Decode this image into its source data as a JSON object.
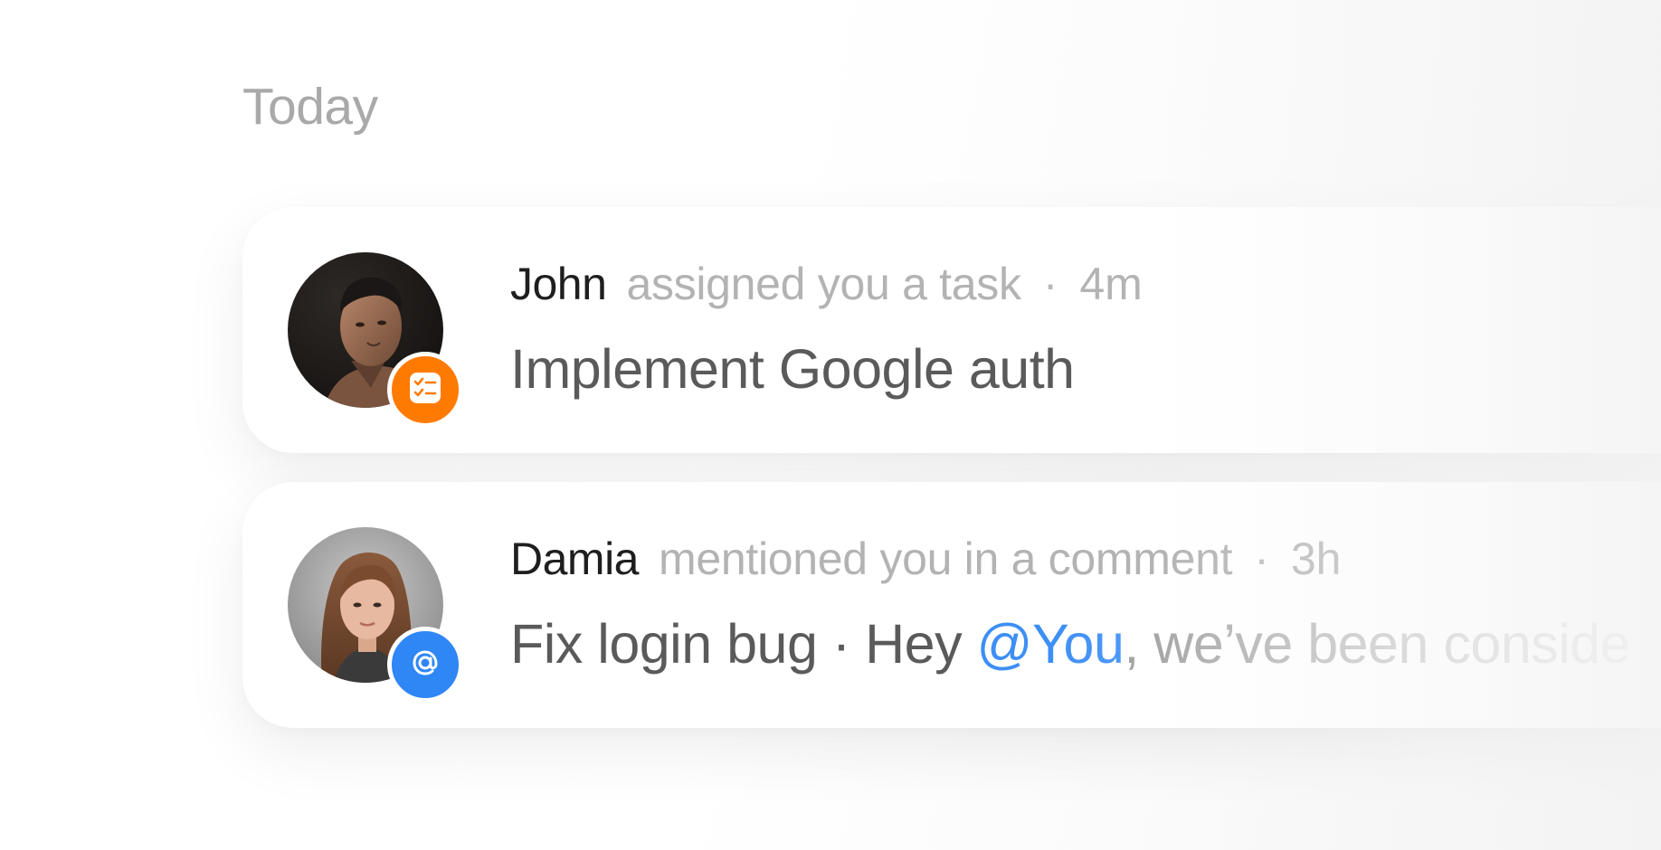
{
  "section": {
    "title": "Today"
  },
  "notifications": [
    {
      "actor": "John",
      "action": "assigned you a task",
      "separator": "·",
      "time": "4m",
      "task": "Implement Google auth",
      "badge_icon": "checklist-icon",
      "badge_color": "#ff7a00"
    },
    {
      "actor": "Damia",
      "action": "mentioned you in a comment",
      "separator": "·",
      "time": "3h",
      "task": "Fix login bug",
      "task_separator": " · ",
      "message_prefix": "Hey ",
      "mention": "@You",
      "message_rest": ", we’ve been conside",
      "badge_icon": "at-sign-icon",
      "badge_color": "#2f86f5"
    }
  ],
  "colors": {
    "mention": "#3d8ff6"
  }
}
